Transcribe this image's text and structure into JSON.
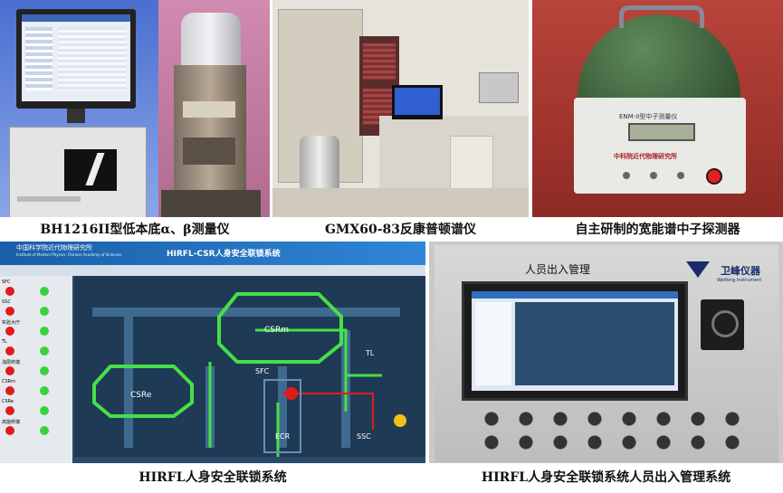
{
  "photo1": {
    "caption": "BH1216II型低本底α、β测量仪"
  },
  "photo2": {
    "caption": "GMX60-83反康普顿谱仪"
  },
  "photo3": {
    "caption": "自主研制的宽能谱中子探测器",
    "device_label": "ENM-II型中子测量仪",
    "maker": "中科院近代物理研究所"
  },
  "photo4": {
    "caption": "HIRFL人身安全联锁系统",
    "institute": "中国科学院近代物理研究所",
    "institute_en": "Institute of Modern Physics, Chinese Academy of Sciences",
    "title": "HIRFL-CSR人身安全联锁系统",
    "rooms": [
      "SFC",
      "SSC",
      "实验大厅",
      "TL",
      "浅层终端",
      "CSRm",
      "CSRe",
      "高能终端"
    ],
    "map_labels": {
      "csrm": "CSRm",
      "csre": "CSRe",
      "tl": "TL",
      "sfc": "SFC",
      "ecr": "ECR",
      "ssc": "SSC"
    },
    "colors": {
      "normal": "#3ad23a",
      "alarm": "#e11b1b",
      "bg": "#1f3a55"
    }
  },
  "photo5": {
    "caption": "HIRFL人身安全联锁系统人员出入管理系统",
    "sign": "人员出入管理",
    "brand": "卫峰仪器",
    "brand_en": "Weifeng Instrument"
  }
}
